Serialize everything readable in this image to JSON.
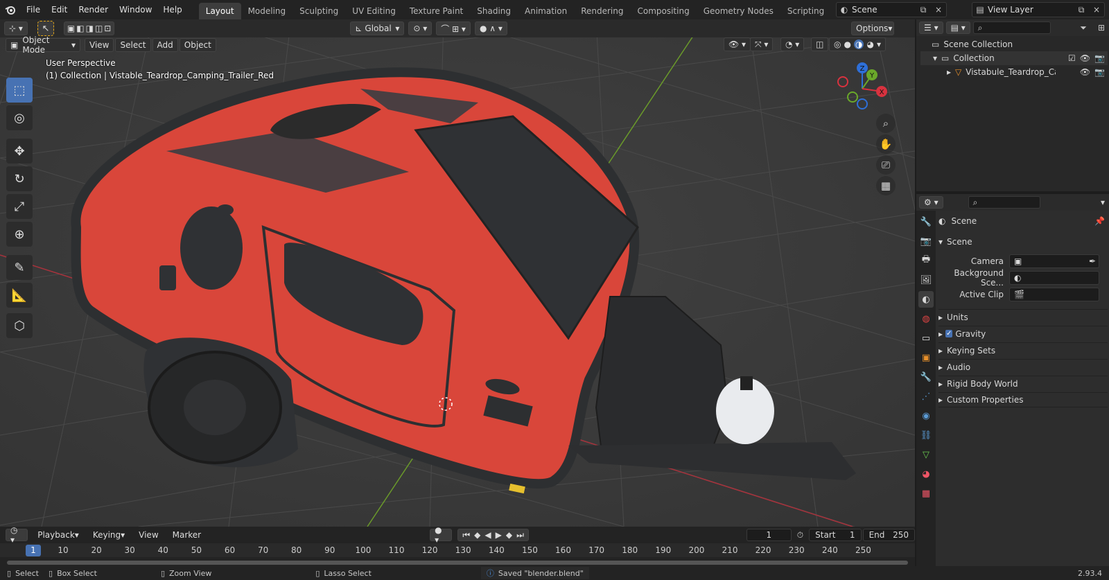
{
  "menu": {
    "items": [
      "File",
      "Edit",
      "Render",
      "Window",
      "Help"
    ]
  },
  "workspace_tabs": [
    {
      "label": "Layout",
      "active": true
    },
    {
      "label": "Modeling"
    },
    {
      "label": "Sculpting"
    },
    {
      "label": "UV Editing"
    },
    {
      "label": "Texture Paint"
    },
    {
      "label": "Shading"
    },
    {
      "label": "Animation"
    },
    {
      "label": "Rendering"
    },
    {
      "label": "Compositing"
    },
    {
      "label": "Geometry Nodes"
    },
    {
      "label": "Scripting"
    }
  ],
  "scene_selector": {
    "value": "Scene"
  },
  "view_layer_selector": {
    "value": "View Layer"
  },
  "viewport": {
    "mode": "Object Mode",
    "menus": [
      "View",
      "Select",
      "Add",
      "Object"
    ],
    "transform_orientation": "Global",
    "options_label": "Options",
    "overlay_line1": "User Perspective",
    "overlay_line2": "(1) Collection | Vistable_Teardrop_Camping_Trailer_Red",
    "gizmo": {
      "x": "X",
      "y": "Y",
      "z": "Z"
    },
    "colors": {
      "background": "#3b3b3b",
      "grid": "#4a4a4a",
      "x_axis": "#a8323c",
      "y_axis": "#6a9a2a",
      "trailer": "#d9463a",
      "trim": "#2d2f31"
    }
  },
  "outliner": {
    "root": "Scene Collection",
    "collection": "Collection",
    "object": "Vistabule_Teardrop_Camp"
  },
  "properties": {
    "context_title": "Scene",
    "panel_title": "Scene",
    "camera_label": "Camera",
    "background_label": "Background Sce...",
    "active_clip_label": "Active Clip",
    "subpanels": [
      {
        "label": "Units"
      },
      {
        "label": "Gravity",
        "checkbox": true
      },
      {
        "label": "Keying Sets"
      },
      {
        "label": "Audio"
      },
      {
        "label": "Rigid Body World"
      },
      {
        "label": "Custom Properties"
      }
    ]
  },
  "timeline": {
    "menus": [
      "Playback",
      "Keying",
      "View",
      "Marker"
    ],
    "current_frame": "1",
    "start_label": "Start",
    "start_value": "1",
    "end_label": "End",
    "end_value": "250",
    "ruler_ticks": [
      "1",
      "10",
      "20",
      "30",
      "40",
      "50",
      "60",
      "70",
      "80",
      "90",
      "100",
      "110",
      "120",
      "130",
      "140",
      "150",
      "160",
      "170",
      "180",
      "190",
      "200",
      "210",
      "220",
      "230",
      "240",
      "250"
    ]
  },
  "statusbar": {
    "select": "Select",
    "box_select": "Box Select",
    "zoom_view": "Zoom View",
    "lasso_select": "Lasso Select",
    "message": "Saved \"blender.blend\"",
    "version": "2.93.4"
  }
}
